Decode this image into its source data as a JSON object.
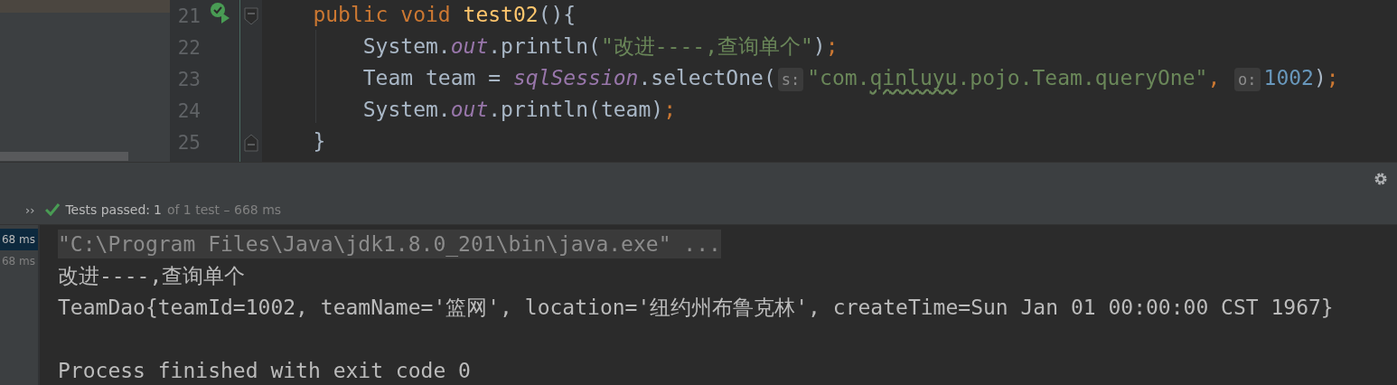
{
  "editor": {
    "lines": [
      {
        "number": "21",
        "run_marker": true,
        "kind": "block_start",
        "tokens": [
          {
            "kind": "keyword",
            "text": "    public void "
          },
          {
            "kind": "method",
            "text": "test02"
          },
          {
            "kind": "plain",
            "text": "(){"
          }
        ]
      },
      {
        "number": "22",
        "run_marker": false,
        "kind": "statement",
        "tokens": [
          {
            "kind": "plain",
            "text": "        System."
          },
          {
            "kind": "field",
            "text": "out"
          },
          {
            "kind": "plain",
            "text": ".println("
          },
          {
            "kind": "string",
            "text": "\"改进----,查询单个\""
          },
          {
            "kind": "plain",
            "text": ")"
          },
          {
            "kind": "keyword",
            "text": ";"
          }
        ]
      },
      {
        "number": "23",
        "run_marker": false,
        "kind": "statement",
        "tokens": [
          {
            "kind": "plain",
            "text": "        Team team = "
          },
          {
            "kind": "field",
            "text": "sqlSession"
          },
          {
            "kind": "plain",
            "text": ".selectOne("
          },
          {
            "kind": "hint",
            "text": "s:"
          },
          {
            "kind": "string",
            "text": "\"com."
          },
          {
            "kind": "typo",
            "text": "qinluyu"
          },
          {
            "kind": "string",
            "text": ".pojo.Team.queryOne\""
          },
          {
            "kind": "keyword",
            "text": ", "
          },
          {
            "kind": "hint",
            "text": "o:"
          },
          {
            "kind": "number",
            "text": "1002"
          },
          {
            "kind": "plain",
            "text": ")"
          },
          {
            "kind": "keyword",
            "text": ";"
          }
        ]
      },
      {
        "number": "24",
        "run_marker": false,
        "kind": "statement",
        "tokens": [
          {
            "kind": "plain",
            "text": "        System."
          },
          {
            "kind": "field",
            "text": "out"
          },
          {
            "kind": "plain",
            "text": ".println(team)"
          },
          {
            "kind": "keyword",
            "text": ";"
          }
        ]
      },
      {
        "number": "25",
        "run_marker": false,
        "kind": "block_end",
        "tokens": [
          {
            "kind": "plain",
            "text": "    }"
          }
        ]
      }
    ]
  },
  "test_status": {
    "expand": "››",
    "label": "Tests passed:",
    "count": "1",
    "detail": "of 1 test – 668 ms",
    "passed": true
  },
  "test_tree": [
    {
      "time": "68 ms",
      "selected": true
    },
    {
      "time": "68 ms",
      "selected": false
    }
  ],
  "console": [
    {
      "kind": "command",
      "text": "\"C:\\Program Files\\Java\\jdk1.8.0_201\\bin\\java.exe\" ..."
    },
    {
      "kind": "output",
      "text": "改进----,查询单个"
    },
    {
      "kind": "output",
      "text": "TeamDao{teamId=1002, teamName='篮网', location='纽约州布鲁克林', createTime=Sun Jan 01 00:00:00 CST 1967}"
    },
    {
      "kind": "blank"
    },
    {
      "kind": "output",
      "text": "Process finished with exit code 0"
    }
  ]
}
